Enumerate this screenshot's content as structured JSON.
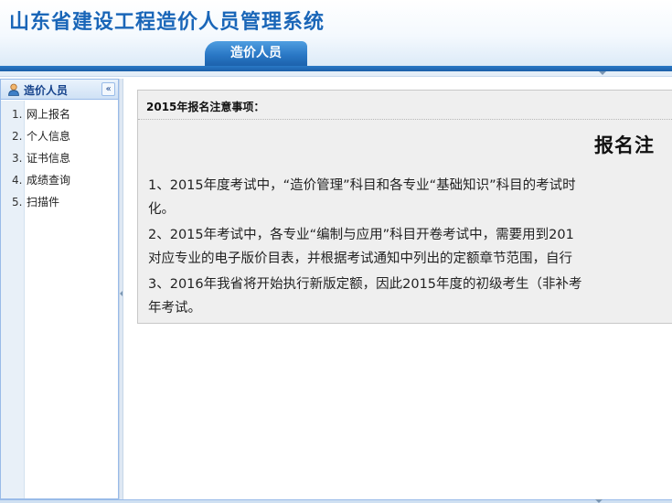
{
  "app": {
    "title": "山东省建设工程造价人员管理系统",
    "active_tab": "造价人员"
  },
  "sidebar": {
    "title": "造价人员",
    "collapse_icon": "double-chevron-left-icon",
    "items": [
      {
        "num": "1.",
        "label": "网上报名"
      },
      {
        "num": "2.",
        "label": "个人信息"
      },
      {
        "num": "3.",
        "label": "证书信息"
      },
      {
        "num": "4.",
        "label": "成绩查询"
      },
      {
        "num": "5.",
        "label": "扫描件"
      }
    ]
  },
  "notice": {
    "header": "2015年报名注意事项：",
    "title": "报名注",
    "lines": [
      "1、2015年度考试中，“造价管理”科目和各专业“基础知识”科目的考试时",
      "化。",
      "2、2015年考试中，各专业“编制与应用”科目开卷考试中，需要用到201",
      "对应专业的电子版价目表，并根据考试通知中列出的定额章节范围，自行",
      "3、2016年我省将开始执行新版定额，因此2015年度的初级考生（非补考",
      "年考试。"
    ]
  },
  "colors": {
    "brand_blue": "#1a66b8",
    "tab_blue": "#2a78c6",
    "panel_border": "#99bbe8",
    "notice_bg": "#efefef"
  }
}
